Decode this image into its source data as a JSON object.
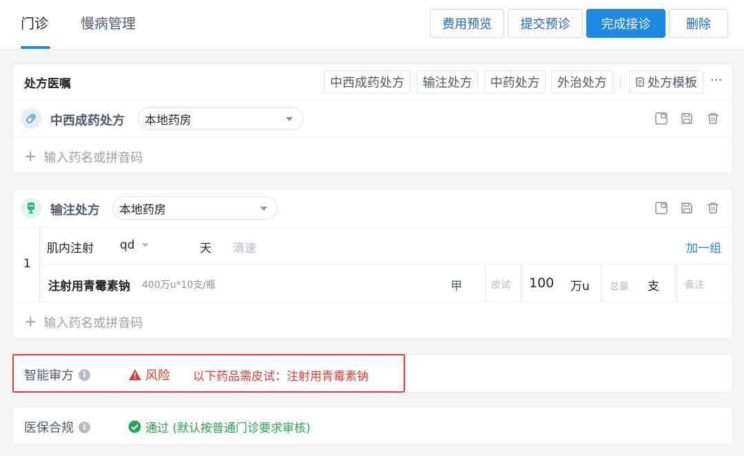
{
  "tabs": {
    "outpatient": "门诊",
    "chronic": "慢病管理"
  },
  "toolbar": {
    "fee_preview": "费用预览",
    "submit_prediagnosis": "提交预诊",
    "finish_visit": "完成接诊",
    "delete": "删除"
  },
  "prescription": {
    "title": "处方医嘱",
    "types": [
      "中西成药处方",
      "输注处方",
      "中药处方",
      "外治处方"
    ],
    "template": "处方模板",
    "more": "···"
  },
  "rx_western": {
    "name": "中西成药处方",
    "pharmacy": "本地药房",
    "add_placeholder": "输入药名或拼音码"
  },
  "rx_infusion": {
    "name": "输注处方",
    "pharmacy": "本地药房",
    "group_no": "1",
    "route": "肌内注射",
    "frequency": "qd",
    "days_unit": "天",
    "drip_rate": "滴速",
    "add_group": "加一组",
    "drug_name": "注射用青霉素钠",
    "drug_spec": "400万u*10支/瓶",
    "grade": "甲",
    "skin_test": "皮试",
    "dose": "100",
    "dose_unit": "万u",
    "total_label": "总量",
    "total_unit": "支",
    "remark": "备注",
    "add_placeholder": "输入药名或拼音码"
  },
  "smart_review": {
    "label": "智能审方",
    "level": "风险",
    "message": "以下药品需皮试：注射用青霉素钠",
    "colors": {
      "risk": "#e53935"
    }
  },
  "insurance": {
    "label": "医保合规",
    "status": "通过 (默认按普通门诊要求审核)",
    "colors": {
      "pass": "#26a65b"
    }
  }
}
